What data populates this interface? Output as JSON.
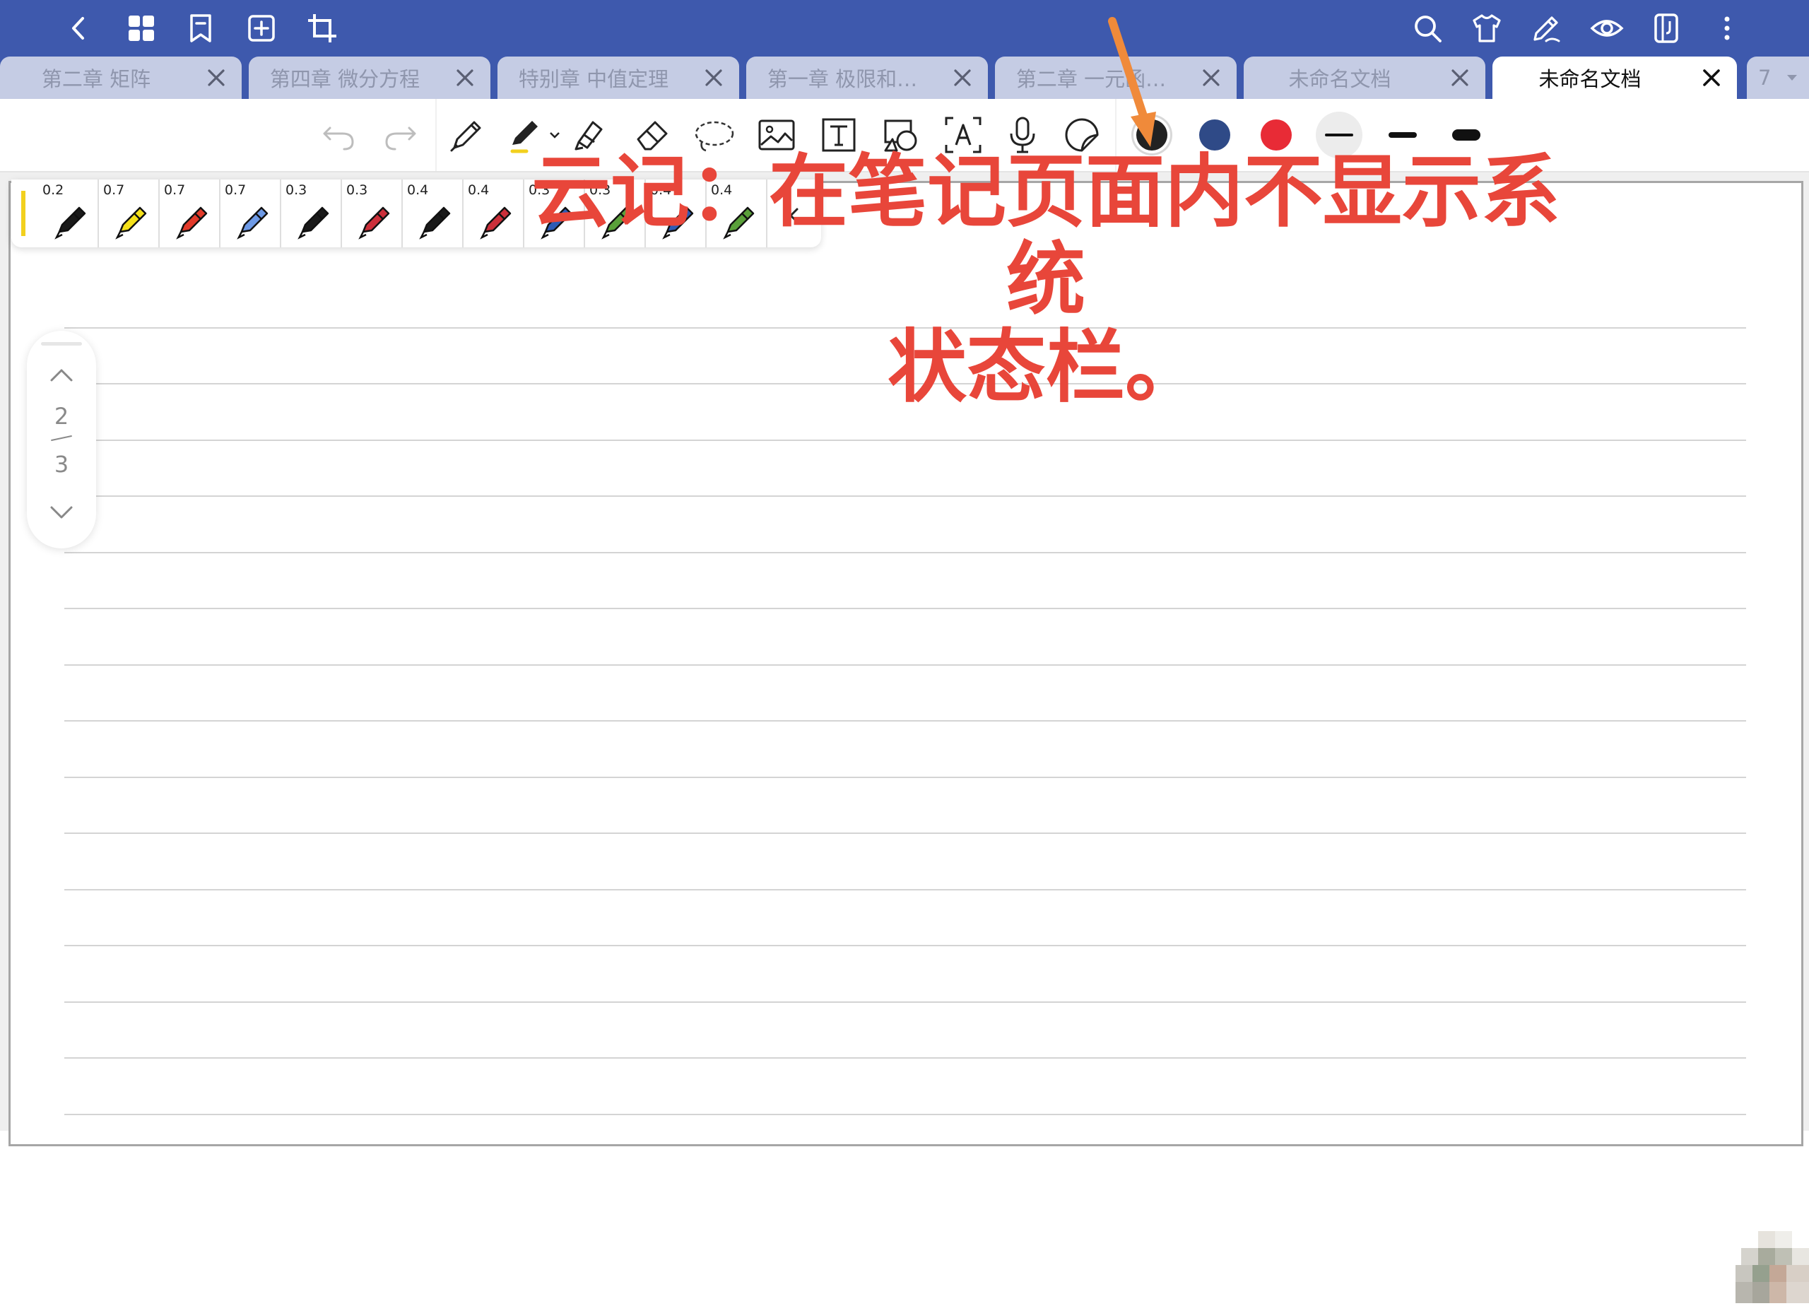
{
  "tabs": [
    {
      "label": "第二章 矩阵",
      "active": false
    },
    {
      "label": "第四章 微分方程",
      "active": false
    },
    {
      "label": "特别章 中值定理",
      "active": false
    },
    {
      "label": "第一章 极限和…",
      "active": false
    },
    {
      "label": "第二章 一元函…",
      "active": false
    },
    {
      "label": "未命名文档",
      "active": false
    },
    {
      "label": "未命名文档",
      "active": true
    }
  ],
  "tab_count": "7",
  "topbar_icons": [
    "back-icon",
    "grid-icon",
    "bookmark-icon",
    "add-page-icon",
    "crop-icon",
    "search-icon",
    "shirt-icon",
    "pen-edit-icon",
    "eye-icon",
    "notebook-icon",
    "more-icon"
  ],
  "toolbar": {
    "tools": [
      "undo-icon",
      "redo-icon",
      "fountain-pen-icon",
      "pen-icon",
      "highlighter-icon",
      "eraser-icon",
      "lasso-icon",
      "image-icon",
      "text-icon",
      "shape-icon",
      "ocr-text-icon",
      "microphone-icon",
      "sticker-icon"
    ],
    "colors": [
      "#222222",
      "#2f4a87",
      "#e82b36"
    ],
    "stroke_widths": [
      "thin",
      "medium",
      "thick"
    ]
  },
  "pen_presets": [
    {
      "size": "0.2",
      "color": "#1a1a1a"
    },
    {
      "size": "0.7",
      "color": "#f5e11a"
    },
    {
      "size": "0.7",
      "color": "#e23a2a"
    },
    {
      "size": "0.7",
      "color": "#6e9ae6"
    },
    {
      "size": "0.3",
      "color": "#1a1a1a"
    },
    {
      "size": "0.3",
      "color": "#cc2f3a"
    },
    {
      "size": "0.4",
      "color": "#1a1a1a"
    },
    {
      "size": "0.4",
      "color": "#cc2f3a"
    },
    {
      "size": "0.3",
      "color": "#2d5bb5"
    },
    {
      "size": "0.3",
      "color": "#5aa03a"
    },
    {
      "size": "0.4",
      "color": "#2d5bb5"
    },
    {
      "size": "0.4",
      "color": "#5aa03a"
    }
  ],
  "page_nav": {
    "current": "2",
    "total": "3"
  },
  "annotation": {
    "line1": "云记：在笔记页面内不显示系统",
    "line2": "状态栏。"
  },
  "annotation_color": "#e8463a",
  "arrow_color": "#f08a3a"
}
